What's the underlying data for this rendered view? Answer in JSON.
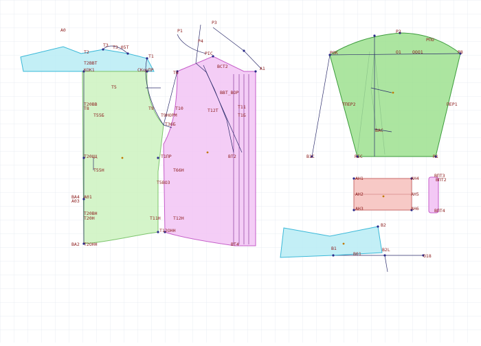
{
  "colors": {
    "background": "#ffffff",
    "grid": "#dde4ec",
    "outline": "#2a2a6a",
    "label": "#8b1a1a",
    "piece_back_fill": "#ccf2c0",
    "piece_front_fill": "#f3c8f5",
    "piece_sleeve_fill": "#9ee08f",
    "piece_shoulder_fill": "#b8ecf5",
    "piece_collar_fill": "#b8ecf5",
    "piece_rect_fill": "#f7c9c6",
    "point": "#2a2a8a"
  },
  "labels": {
    "l_A0": "А0",
    "l_T2": "Т2",
    "l_T3": "Т3",
    "l_T3_1": "Т3_05Т",
    "l_T1": "Т1",
    "l_T2bv": "Т2ВВТ",
    "l_KOK1": "КОК1",
    "l_Skpr": "СКорПР",
    "l_T6": "Т6",
    "l_T5": "Т5",
    "l_T20": "Т20ВВ",
    "l_T8": "Т8",
    "l_T55": "Т55Б",
    "l_T20c": "Т20ЦЦ",
    "l_T55h": "Т55Н",
    "l_Ab4": "ВА4",
    "l_A01": "А01",
    "l_A03": "А03",
    "l_T20bh": "Т20ВН",
    "l_T20h": "Т20Н",
    "l_T2ohh": "Т2ОНН",
    "l_Ab2": "ВА2",
    "l_P1": "Р1",
    "l_P3": "Р3",
    "l_P4": "Р4",
    "l_PIC": "РIС",
    "l_BCT2": "ВСТ2",
    "l_A1": "А1",
    "l_T10": "Т10",
    "l_T9": "Т9",
    "l_T9hop": "Т9НОРМ",
    "l_T36": "Т36Б",
    "l_T12": "Т12Т",
    "l_T11": "Т11",
    "l_T1pr": "Т1ПР",
    "l_T66": "Т66Н",
    "l_T5c": "Т5ВОЗ",
    "l_T11h": "Т11Н",
    "l_T12h": "Т12Н",
    "l_T12ohh": "Т12ОНН",
    "l_BBT": "ВВТ_ВОР",
    "l_T1b": "Т1Б",
    "l_Bt2": "ВТ2",
    "l_Bt4": "ВТ4",
    "l_PIK": "РОК",
    "l_P2": "Р2",
    "l_Pno": "РПО",
    "l_P8": "Р8",
    "l_O1": "О1",
    "l_OO1": "ООО1",
    "l_Per2": "ТПЕР2",
    "l_Per1": "ПЕР1",
    "l_B1C": "В1С",
    "l_Bac": "ВАС",
    "l_RIC": "RIC",
    "l_R1": "R1",
    "l_Ah1": "АН1",
    "l_Ah4": "АН4",
    "l_Ah2": "АН2",
    "l_Ah5": "АН5",
    "l_Ah3": "АН3",
    "l_Ah6": "АН6",
    "l_Bn3": "ВПТ3",
    "l_Bn4": "ВПТ4",
    "l_Bn2": "ВПТ2",
    "l_B2": "В2",
    "l_B1": "В1",
    "l_B01": "В01",
    "l_B2l": "В2L",
    "l_O18": "О18"
  }
}
